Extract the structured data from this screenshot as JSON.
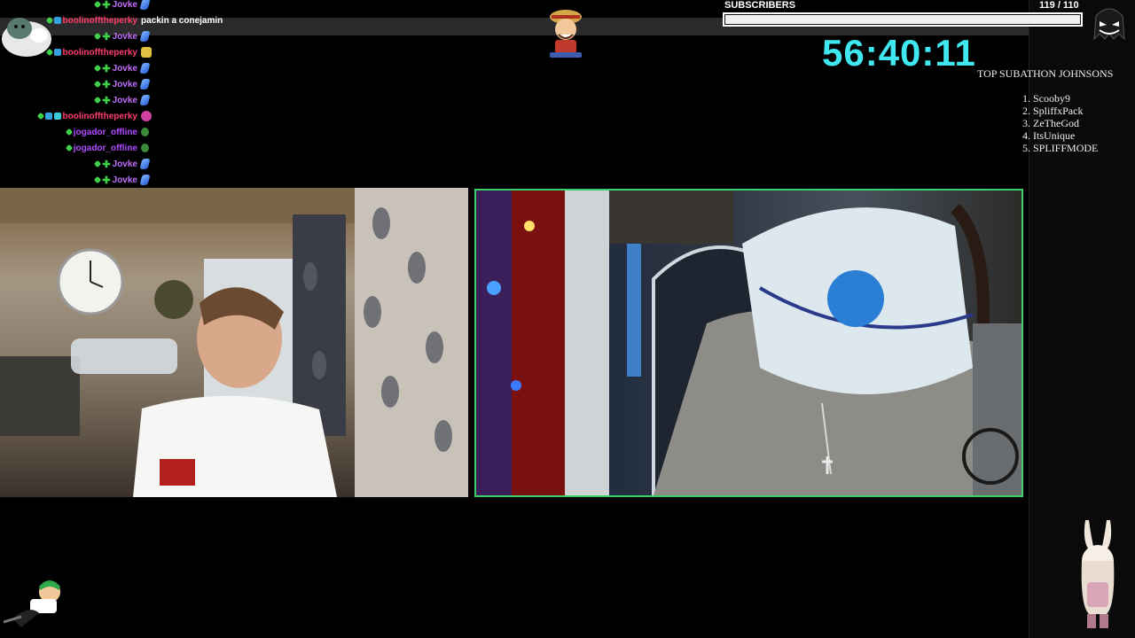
{
  "chat": {
    "lines": [
      {
        "user": "Jovke",
        "color": "#c070ff",
        "message": "",
        "badges": [
          "x",
          "plus"
        ],
        "emote": "feather"
      },
      {
        "user": "boolinofftheperky",
        "color": "#ff3b6b",
        "message": "packin a conejamin",
        "badges": [
          "x",
          "blue"
        ],
        "emote": ""
      },
      {
        "user": "Jovke",
        "color": "#c070ff",
        "message": "",
        "badges": [
          "x",
          "plus"
        ],
        "emote": "feather"
      },
      {
        "user": "boolinofftheperky",
        "color": "#ff3b6b",
        "message": "",
        "badges": [
          "x",
          "blue"
        ],
        "emote": "gold"
      },
      {
        "user": "Jovke",
        "color": "#c070ff",
        "message": "",
        "badges": [
          "x",
          "plus"
        ],
        "emote": "feather"
      },
      {
        "user": "Jovke",
        "color": "#c070ff",
        "message": "",
        "badges": [
          "x",
          "plus"
        ],
        "emote": "feather"
      },
      {
        "user": "Jovke",
        "color": "#c070ff",
        "message": "",
        "badges": [
          "x",
          "plus"
        ],
        "emote": "feather"
      },
      {
        "user": "boolinofftheperky",
        "color": "#ff3b6b",
        "message": "",
        "badges": [
          "x",
          "blue",
          "cyan"
        ],
        "emote": "pink"
      },
      {
        "user": "jogador_offline",
        "color": "#b04cff",
        "message": "",
        "badges": [
          "x"
        ],
        "emote": "green"
      },
      {
        "user": "jogador_offline",
        "color": "#b04cff",
        "message": "",
        "badges": [
          "x"
        ],
        "emote": "green"
      },
      {
        "user": "Jovke",
        "color": "#c070ff",
        "message": "",
        "badges": [
          "x",
          "plus"
        ],
        "emote": "feather"
      },
      {
        "user": "Jovke",
        "color": "#c070ff",
        "message": "",
        "badges": [
          "x",
          "plus"
        ],
        "emote": "feather"
      }
    ]
  },
  "subscribers": {
    "title": "SUBSCRIBERS",
    "count": "119",
    "goal": "/ 110",
    "progress": 1.0
  },
  "timer": "56:40:11",
  "leaderboard": {
    "title": "TOP SUBATHON JOHNSONS",
    "entries": [
      "1. Scooby9",
      "2. SpliffxPack",
      "3. ZeTheGod",
      "4. ItsUnique",
      "5. SPLIFFMODE"
    ]
  },
  "colors": {
    "accent_timer": "#3fe8f0",
    "cam_border": "#3ad16a",
    "background": "#000000"
  },
  "icons": {
    "top_center": "pirate-mascot-icon",
    "top_right": "ghost-emote-icon",
    "top_left": "snorlax-icon",
    "bottom_left": "chibi-character-icon",
    "bottom_right": "bunny-character-icon"
  }
}
